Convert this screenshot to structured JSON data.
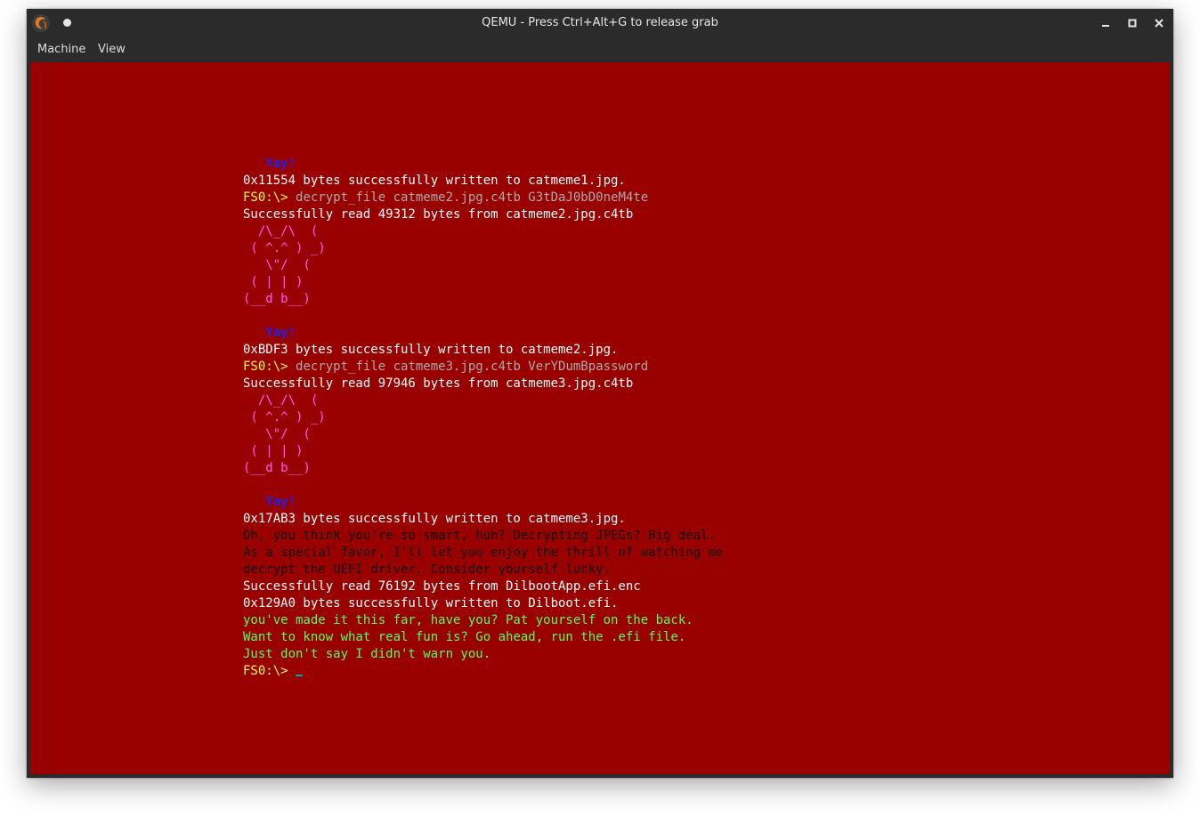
{
  "window": {
    "title": "QEMU - Press Ctrl+Alt+G to release grab",
    "icons": {
      "app": "qemu-logo-icon",
      "pin": "sticky-dot-icon",
      "minimize": "minimize-icon",
      "maximize": "maximize-icon",
      "close": "close-icon"
    }
  },
  "menu": {
    "machine": "Machine",
    "view": "View"
  },
  "colors": {
    "screen_background": "#990000",
    "prompt": "#ffff55",
    "command": "#aaaaaa",
    "output": "#ffffff",
    "ascii_art": "#ff55ff",
    "yay": "#2020ee",
    "taunt": "#111111",
    "success": "#55ff55",
    "cursor": "#00aaaa"
  },
  "terminal": {
    "lines": [
      {
        "spans": [
          {
            "t": "   Yay!",
            "c": "blue"
          }
        ]
      },
      {
        "spans": [
          {
            "t": "0x11554 bytes successfully written to catmeme1.jpg.",
            "c": "white"
          }
        ]
      },
      {
        "spans": [
          {
            "t": "FS0:\\> ",
            "c": "yellow"
          },
          {
            "t": "decrypt_file catmeme2.jpg.c4tb G3tDaJ0bD0neM4te",
            "c": "gray"
          }
        ]
      },
      {
        "spans": [
          {
            "t": "Successfully read 49312 bytes from catmeme2.jpg.c4tb",
            "c": "white"
          }
        ]
      },
      {
        "spans": [
          {
            "t": "  /\\_/\\  (",
            "c": "pink"
          }
        ]
      },
      {
        "spans": [
          {
            "t": " ( ^.^ ) _)",
            "c": "pink"
          }
        ]
      },
      {
        "spans": [
          {
            "t": "   \\\"/  (",
            "c": "pink"
          }
        ]
      },
      {
        "spans": [
          {
            "t": " ( | | )",
            "c": "pink"
          }
        ]
      },
      {
        "spans": [
          {
            "t": "(__d b__)",
            "c": "pink"
          }
        ]
      },
      {
        "spans": [
          {
            "t": "",
            "c": "white"
          }
        ]
      },
      {
        "spans": [
          {
            "t": "   Yay!",
            "c": "blue"
          }
        ]
      },
      {
        "spans": [
          {
            "t": "0xBDF3 bytes successfully written to catmeme2.jpg.",
            "c": "white"
          }
        ]
      },
      {
        "spans": [
          {
            "t": "FS0:\\> ",
            "c": "yellow"
          },
          {
            "t": "decrypt_file catmeme3.jpg.c4tb VerYDumBpassword",
            "c": "gray"
          }
        ]
      },
      {
        "spans": [
          {
            "t": "Successfully read 97946 bytes from catmeme3.jpg.c4tb",
            "c": "white"
          }
        ]
      },
      {
        "spans": [
          {
            "t": "  /\\_/\\  (",
            "c": "pink"
          }
        ]
      },
      {
        "spans": [
          {
            "t": " ( ^.^ ) _)",
            "c": "pink"
          }
        ]
      },
      {
        "spans": [
          {
            "t": "   \\\"/  (",
            "c": "pink"
          }
        ]
      },
      {
        "spans": [
          {
            "t": " ( | | )",
            "c": "pink"
          }
        ]
      },
      {
        "spans": [
          {
            "t": "(__d b__)",
            "c": "pink"
          }
        ]
      },
      {
        "spans": [
          {
            "t": "",
            "c": "white"
          }
        ]
      },
      {
        "spans": [
          {
            "t": "   Yay!",
            "c": "blue"
          }
        ]
      },
      {
        "spans": [
          {
            "t": "0x17AB3 bytes successfully written to catmeme3.jpg.",
            "c": "white"
          }
        ]
      },
      {
        "spans": [
          {
            "t": "Oh, you think you're so smart, huh? Decrypting JPEGs? Big deal.",
            "c": "black"
          }
        ]
      },
      {
        "spans": [
          {
            "t": "As a special favor, I'll let you enjoy the thrill of watching me",
            "c": "black"
          }
        ]
      },
      {
        "spans": [
          {
            "t": "decrypt the UEFI driver. Consider yourself lucky.",
            "c": "black"
          }
        ]
      },
      {
        "spans": [
          {
            "t": "Successfully read 76192 bytes from DilbootApp.efi.enc",
            "c": "white"
          }
        ]
      },
      {
        "spans": [
          {
            "t": "0x129A0 bytes successfully written to Dilboot.efi.",
            "c": "white"
          }
        ]
      },
      {
        "spans": [
          {
            "t": "you've made it this far, have you? Pat yourself on the back.",
            "c": "green"
          }
        ]
      },
      {
        "spans": [
          {
            "t": "Want to know what real fun is? Go ahead, run the .efi file.",
            "c": "green"
          }
        ]
      },
      {
        "spans": [
          {
            "t": "Just don't say I didn't warn you.",
            "c": "green"
          }
        ]
      },
      {
        "spans": [
          {
            "t": "FS0:\\> ",
            "c": "yellow"
          }
        ],
        "cursor": true
      }
    ]
  }
}
